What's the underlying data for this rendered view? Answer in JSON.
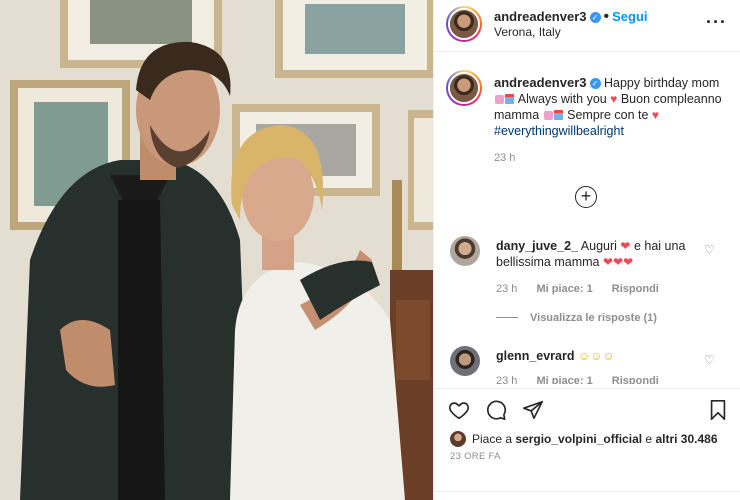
{
  "header": {
    "username": "andreadenver3",
    "follow_label": "Segui",
    "location": "Verona, Italy",
    "more_icon": "more-options-icon"
  },
  "caption": {
    "username": "andreadenver3",
    "part1": "Happy birthday mom",
    "part2": "Always with you",
    "part3": "Buon compleanno mamma",
    "part4": "Sempre con te",
    "hashtag": "#everythingwillbealright",
    "time": "23 h"
  },
  "comments": [
    {
      "username": "dany_juve_2_",
      "text": "Auguri",
      "text2": "e hai una bellissima mamma",
      "time": "23 h",
      "likes": "Mi piace: 1",
      "reply": "Rispondi",
      "view_replies": "Visualizza le risposte (1)"
    },
    {
      "username": "glenn_evrard",
      "text": "",
      "time": "23 h",
      "likes": "Mi piace: 1",
      "reply": "Rispondi"
    }
  ],
  "actions": {
    "likes_prefix": "Piace a",
    "liked_by": "sergio_volpini_official",
    "likes_mid": "e",
    "likes_others": "altri 30.486",
    "posted_time": "23 ORE FA"
  },
  "colors": {
    "link_blue": "#0095f6",
    "verified_blue": "#3897f0",
    "heart_red": "#ed4956",
    "meta_gray": "#8e8e8e"
  }
}
